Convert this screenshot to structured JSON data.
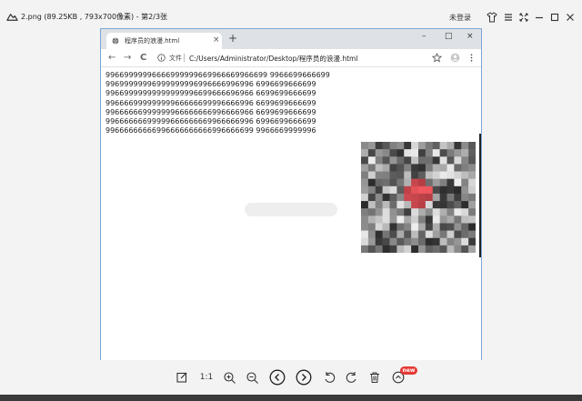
{
  "viewer": {
    "title": "2.png (89.25KB , 793x700像素) - 第2/3张",
    "login": "未登录",
    "icons": [
      "shirt-icon",
      "menu-icon",
      "fullscreen-icon",
      "minimize-icon",
      "maximize-icon",
      "close-icon"
    ],
    "toolbar": {
      "ratio_label": "1:1",
      "new_badge": "new",
      "icons": [
        "edit-icon",
        "ratio-icon",
        "zoom-in-icon",
        "zoom-out-icon",
        "previous-icon",
        "next-icon",
        "rotate-left-icon",
        "rotate-right-icon",
        "delete-icon",
        "more-icon"
      ]
    },
    "colors": {
      "chrome": "#f3f3f3",
      "badge": "#e53935"
    }
  },
  "browser": {
    "tab_title": "程序员的浪漫.html",
    "tab_close": "×",
    "new_tab": "+",
    "window_controls": [
      "–",
      "□",
      "×"
    ],
    "nav": {
      "back": "←",
      "forward": "→",
      "reload": "C"
    },
    "file_label": "文件",
    "url": "C:/Users/Administrator/Desktop/程序员的浪漫.html",
    "colors": {
      "tabstrip": "#dee1e6",
      "frame": "#7aa7d6"
    }
  },
  "content": {
    "lines": [
      "99669999996666999999669966669966699 9966699666699",
      "99699999996999999996996666996996 6996699666699",
      "99669999999999999996699666696966 6699699666699",
      "99666699999999966666699996666996 6699699666699",
      "99666666999999966666666996666966 6699699666699",
      "99666666699999666666669966666996 6996699666699",
      "99666666666996666666666996666699 9966669999996"
    ]
  }
}
